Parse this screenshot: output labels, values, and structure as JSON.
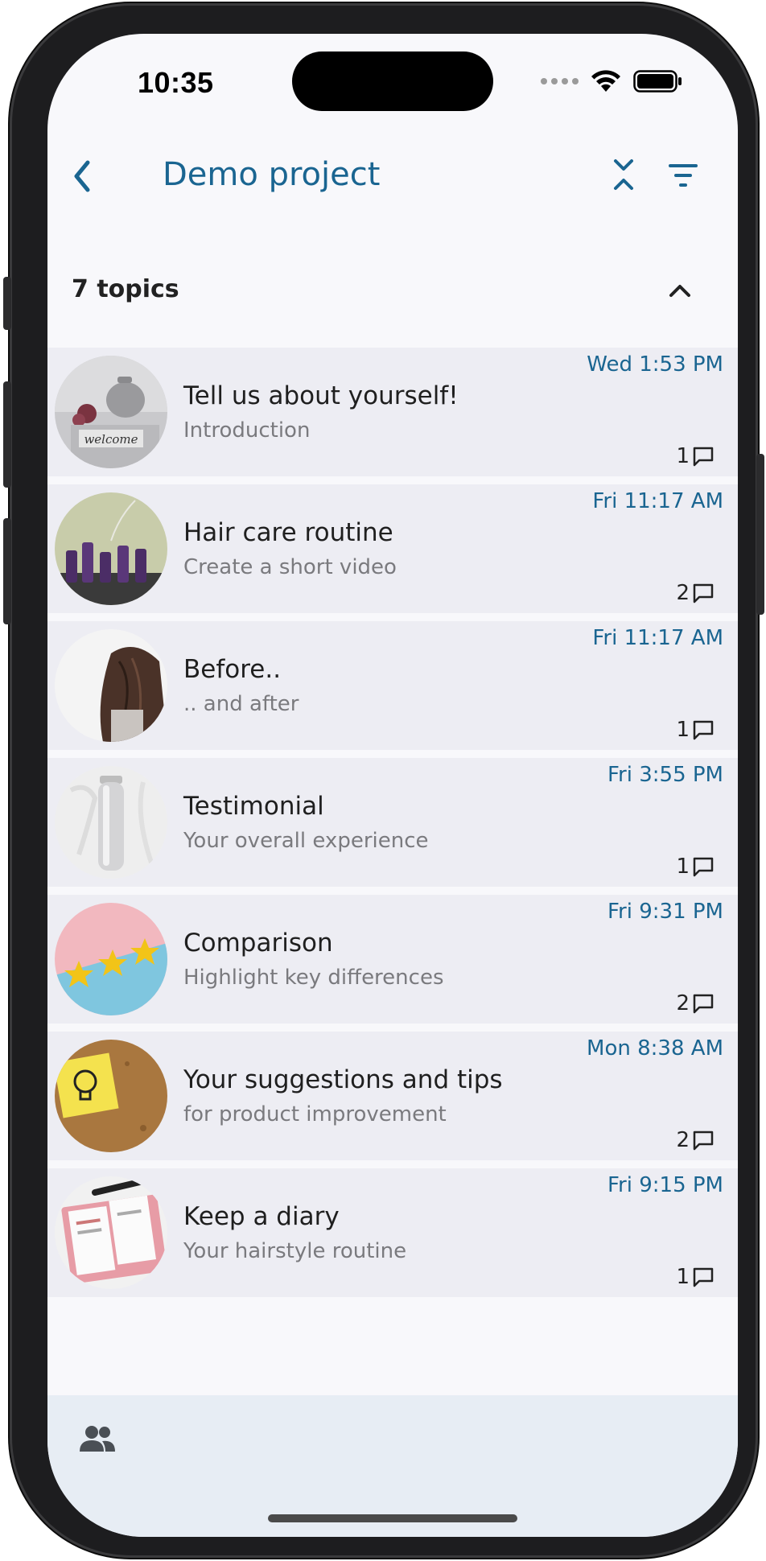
{
  "status_bar": {
    "time": "10:35"
  },
  "nav": {
    "title": "Demo project"
  },
  "topics_header": {
    "count_label": "7 topics"
  },
  "colors": {
    "accent": "#1a6591",
    "row_bg": "#ededf3",
    "bottom_bar_bg": "#e7edf4"
  },
  "topics": [
    {
      "title": "Tell us about yourself!",
      "subtitle": "Introduction",
      "time": "Wed 1:53 PM",
      "count": "1",
      "image": "welcome-sign-and-teapot"
    },
    {
      "title": "Hair care routine",
      "subtitle": "Create a short video",
      "time": "Fri 11:17 AM",
      "count": "2",
      "image": "purple-bottles"
    },
    {
      "title": "Before..",
      "subtitle": ".. and after",
      "time": "Fri 11:17 AM",
      "count": "1",
      "image": "woman-hair"
    },
    {
      "title": "Testimonial",
      "subtitle": "Your overall experience",
      "time": "Fri 3:55 PM",
      "count": "1",
      "image": "tube-product"
    },
    {
      "title": "Comparison",
      "subtitle": "Highlight key differences",
      "time": "Fri 9:31 PM",
      "count": "2",
      "image": "stars"
    },
    {
      "title": "Your suggestions and tips",
      "subtitle": "for product improvement",
      "time": "Mon 8:38 AM",
      "count": "2",
      "image": "lightbulb-sticky-note"
    },
    {
      "title": "Keep a diary",
      "subtitle": "Your hairstyle routine",
      "time": "Fri 9:15 PM",
      "count": "1",
      "image": "planner-notebook"
    }
  ]
}
